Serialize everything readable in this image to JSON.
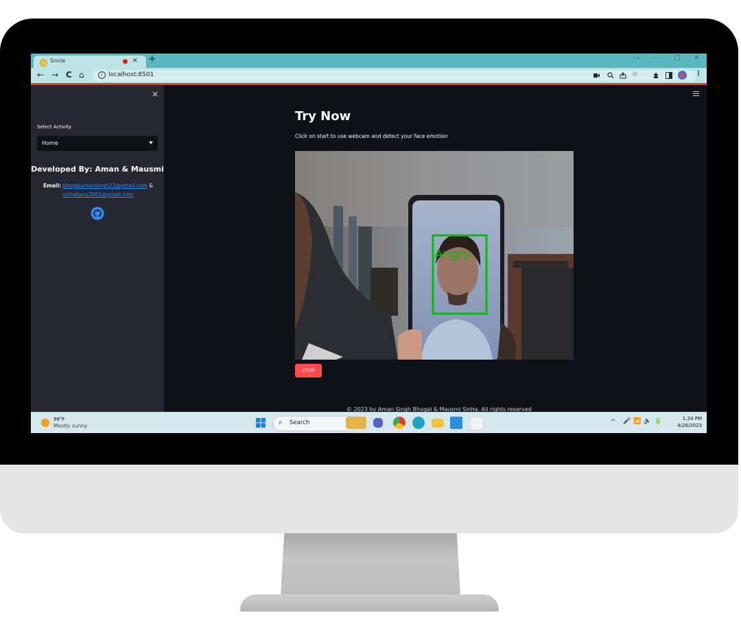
{
  "browser": {
    "tab_title": "Smile",
    "tab_close": "×",
    "new_tab": "+",
    "window_controls": [
      "﹀",
      "–",
      "▢",
      "✕"
    ],
    "nav": {
      "back": "←",
      "forward": "→",
      "reload": "C",
      "home": "⌂"
    },
    "url": "localhost:8501",
    "info_icon": "i"
  },
  "sidebar": {
    "close": "×",
    "select_label": "Select Activity",
    "select_value": "Home",
    "developed_by": "Developed By: Aman & Mausmi",
    "email_label": "Email:",
    "email_1": "bhogalamansingh22@gmail.com",
    "email_sep": "&",
    "email_2": "sinhatanu2001@gmail.com"
  },
  "main": {
    "title": "Try Now",
    "subtitle": "Click on start to use webcam and detect your face emotion",
    "detection_label": "Angry",
    "stop_button": "STOP",
    "footer": "© 2023 by Aman Singh Bhogal & Mausmi Sinha. All rights reserved"
  },
  "taskbar": {
    "weather_temp": "98°F",
    "weather_desc": "Mostly sunny",
    "search_placeholder": "Search",
    "tray_chevron": "^",
    "clock_time": "1:24 PM",
    "clock_date": "4/26/2023"
  },
  "colors": {
    "app_bg": "#0e1117",
    "sidebar_bg": "#262730",
    "stop_button": "#ff4b4b",
    "link": "#2b8cff",
    "detection_box": "#00c000",
    "browser_accent": "#5cb8bf"
  }
}
